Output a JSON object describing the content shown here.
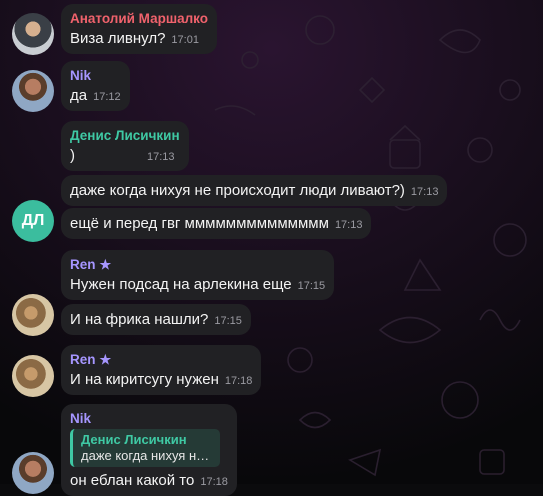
{
  "messages": [
    {
      "sender": "Анатолий Маршалко",
      "text": "Виза ливнул?",
      "time": "17:01"
    },
    {
      "sender": "Nik",
      "text": "да",
      "time": "17:12"
    },
    {
      "sender": "Денис Лисичкин",
      "text": ")",
      "time": "17:13"
    },
    {
      "text": "даже когда нихуя не происходит люди ливают?)",
      "time": "17:13"
    },
    {
      "text": "ещё и перед гвг мммммммммммммм",
      "time": "17:13"
    },
    {
      "sender": "Ren",
      "text": "Нужен подсад на арлекина еще",
      "time": "17:15"
    },
    {
      "text": "И на фрика нашли?",
      "time": "17:15"
    },
    {
      "sender": "Ren",
      "text": "И на киритсугу нужен",
      "time": "17:18"
    },
    {
      "sender": "Nik",
      "reply_to": {
        "name": "Денис Лисичкин",
        "text": "даже когда нихуя не п..."
      },
      "text": "он еблан какой то",
      "time": "17:18"
    }
  ],
  "avatars": {
    "denis_initials": "ДЛ",
    "denis_color": "#3bbd9e"
  },
  "colors": {
    "background": "#0b0b0d",
    "bubble": "#212124",
    "name_red": "#f0626c",
    "name_purple": "#a696ff",
    "name_green": "#3fc9a4",
    "time": "#9b9ba2"
  },
  "icons": [
    "premium-star-icon"
  ]
}
